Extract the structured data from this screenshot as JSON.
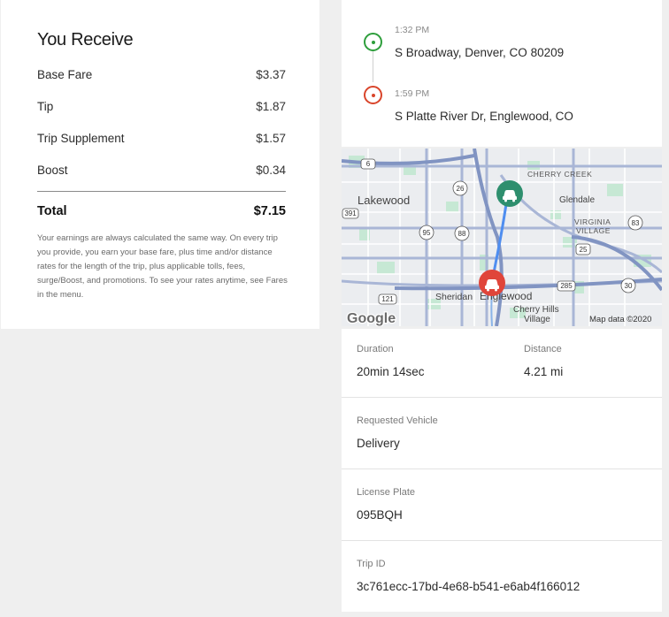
{
  "earnings": {
    "title": "You Receive",
    "items": [
      {
        "label": "Base Fare",
        "amount": "$3.37"
      },
      {
        "label": "Tip",
        "amount": "$1.87"
      },
      {
        "label": "Trip Supplement",
        "amount": "$1.57"
      },
      {
        "label": "Boost",
        "amount": "$0.34"
      }
    ],
    "total_label": "Total",
    "total_amount": "$7.15",
    "note": "Your earnings are always calculated the same way. On every trip you provide, you earn your base fare, plus time and/or distance rates for the length of the trip, plus applicable tolls, fees, surge/Boost, and promotions. To see your rates anytime, see Fares in the menu."
  },
  "route": {
    "pickup": {
      "time": "1:32 PM",
      "address": "S Broadway, Denver, CO 80209",
      "color": "#2e9e3c"
    },
    "dropoff": {
      "time": "1:59 PM",
      "address": "S Platte River Dr, Englewood, CO",
      "color": "#d9452b"
    }
  },
  "map": {
    "labels": {
      "lakewood": "Lakewood",
      "cherry_creek": "CHERRY CREEK",
      "glendale": "Glendale",
      "virginia": "VIRGINIA",
      "village": "VILLAGE",
      "sheridan": "Sheridan",
      "englewood": "Englewood",
      "cherry_hills": "Cherry Hills",
      "cherry_hills_2": "Village",
      "brand": "Google",
      "attribution": "Map data ©2020"
    },
    "shields": [
      "6",
      "26",
      "391",
      "95",
      "88",
      "121",
      "285",
      "30",
      "83",
      "25"
    ],
    "marker_colors": {
      "pickup": "#2e8f6e",
      "dropoff": "#e0453a"
    }
  },
  "details": {
    "duration_label": "Duration",
    "duration_value": "20min 14sec",
    "distance_label": "Distance",
    "distance_value": "4.21 mi",
    "vehicle_label": "Requested Vehicle",
    "vehicle_value": "Delivery",
    "plate_label": "License Plate",
    "plate_value": "095BQH",
    "trip_label": "Trip ID",
    "trip_value": "3c761ecc-17bd-4e68-b541-e6ab4f166012"
  }
}
